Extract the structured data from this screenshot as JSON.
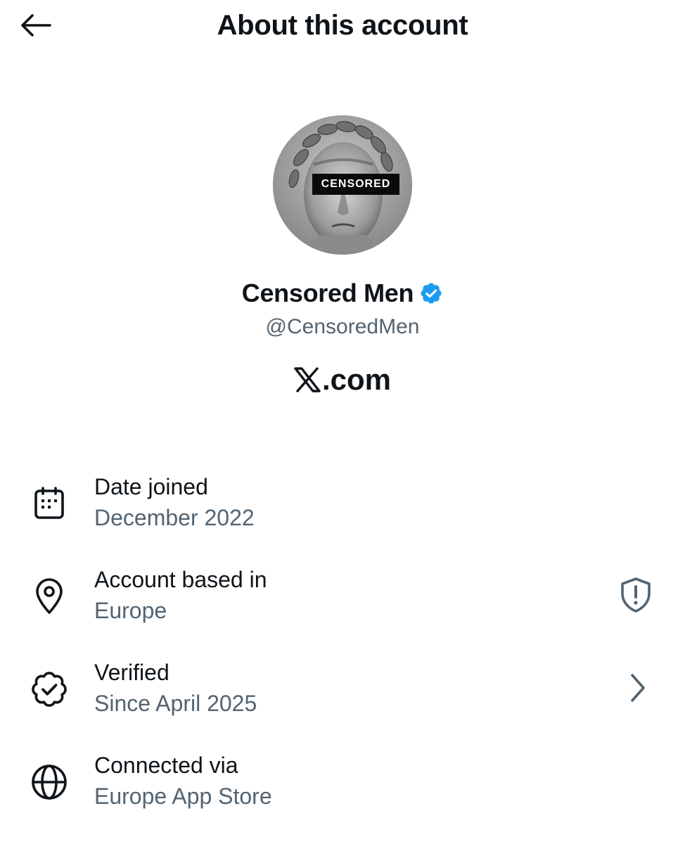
{
  "header": {
    "title": "About this account",
    "back_icon": "arrow-left-icon"
  },
  "profile": {
    "avatar_overlay_text": "CENSORED",
    "display_name": "Censored Men",
    "handle": "@CensoredMen",
    "verified_badge_color": "#1d9bf0",
    "platform_text": ".com"
  },
  "details": [
    {
      "icon": "calendar-icon",
      "label": "Date joined",
      "value": "December 2022"
    },
    {
      "icon": "location-pin-icon",
      "label": "Account based in",
      "value": "Europe",
      "trailing_icon": "shield-alert-icon"
    },
    {
      "icon": "verified-badge-icon",
      "label": "Verified",
      "value": "Since April 2025",
      "trailing_icon": "chevron-right-icon"
    },
    {
      "icon": "globe-icon",
      "label": "Connected via",
      "value": "Europe App Store"
    }
  ],
  "colors": {
    "primary_text": "#0f1419",
    "secondary_text": "#536471",
    "accent": "#1d9bf0"
  }
}
